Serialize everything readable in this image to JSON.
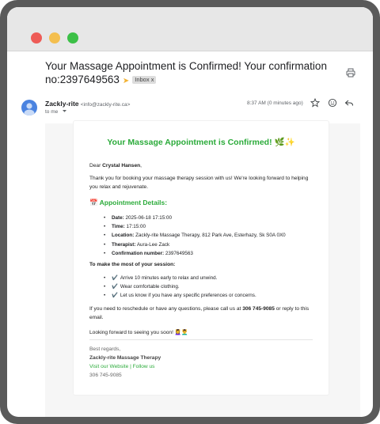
{
  "email": {
    "subject": "Your Massage Appointment is Confirmed! Your confirmation no:2397649563",
    "subject_arrow": "➤",
    "label": "Inbox",
    "label_close": "x",
    "sender_name": "Zackly-rite",
    "sender_email": "<info@zackly-rite.ca>",
    "to_line": "to me",
    "time": "8:37 AM (0 minutes ago)"
  },
  "body": {
    "title": "Your Massage Appointment is Confirmed! 🌿✨",
    "greeting_prefix": "Dear ",
    "customer_name": "Crystal Hansen",
    "greeting_suffix": ",",
    "intro": "Thank you for booking your massage therapy session with us! We're looking forward to helping you relax and rejuvenate.",
    "details_heading": "📅 Appointment Details:",
    "details": [
      {
        "label": "Date:",
        "value": "2025-06-18 17:15:00"
      },
      {
        "label": "Time:",
        "value": "17:15:00"
      },
      {
        "label": "Location:",
        "value": "Zackly-rite Massage Therapy, 812 Park Ave, Esterhazy, Sk S0A 0X0"
      },
      {
        "label": "Therapist:",
        "value": "Aura-Lee Zack"
      },
      {
        "label": "Confirmation number:",
        "value": "2397649563"
      }
    ],
    "tips_heading": "To make the most of your session:",
    "tips": [
      "Arrive 10 minutes early to relax and unwind.",
      "Wear comfortable clothing.",
      "Let us know if you have any specific preferences or concerns."
    ],
    "tip_check": "✔️",
    "reschedule_prefix": "If you need to reschedule or have any questions, please call us at ",
    "phone_bold": "306 745-9085",
    "reschedule_suffix": " or reply to this email.",
    "closing": "Looking forward to seeing you soon! 💆‍♀️💆‍♂️",
    "regards": "Best regards,",
    "company": "Zackly-rite Massage Therapy",
    "link_website": "Visit our Website",
    "link_sep": " | ",
    "link_follow": "Follow us",
    "phone": "306 745-9085"
  },
  "colors": {
    "accent": "#2bab3a",
    "avatar": "#4a83e0"
  },
  "icons": [
    "print-icon",
    "star-icon",
    "emoji-icon",
    "reply-icon",
    "chevron-down-icon",
    "avatar-icon"
  ]
}
